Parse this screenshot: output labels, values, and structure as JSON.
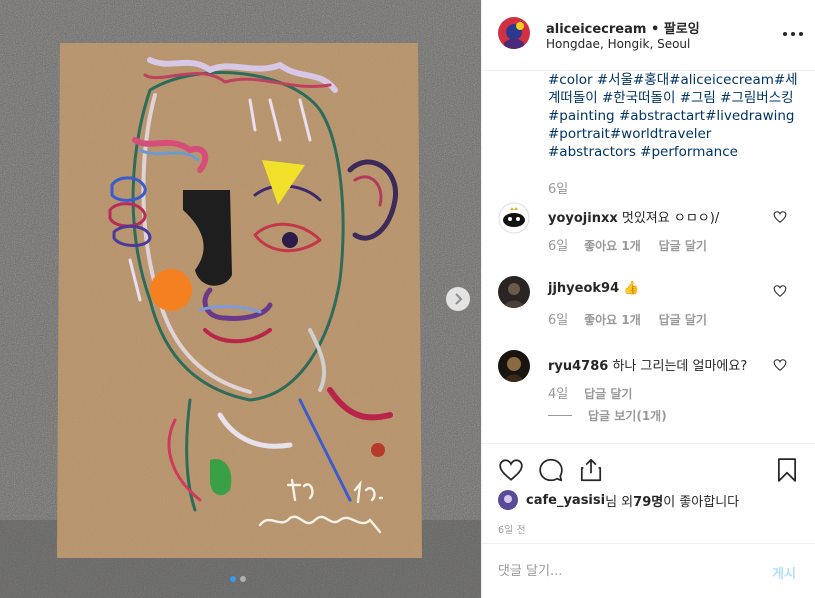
{
  "post": {
    "username": "aliceicecream",
    "separator": "•",
    "follow_label": "팔로잉",
    "location": "Hongdae, Hongik, Seoul",
    "more_options_icon": "more-options-icon"
  },
  "caption": {
    "hashtags": [
      "#color",
      "#서울",
      "#홍대",
      "#aliceicecream",
      "#세계떠돌이",
      "#한국떠돌이",
      "#그림",
      "#그림버스킹",
      "#painting",
      "#abstractart",
      "#livedrawing",
      "#portrait",
      "#worldtraveler",
      "#abstractors",
      "#performance"
    ],
    "time": "6일"
  },
  "comments": [
    {
      "user": "yoyojinxx",
      "text": "멋있져요 ㅇㅁㅇ)/",
      "time": "6일",
      "likes_label": "좋아요 1개",
      "reply_label": "답글 달기"
    },
    {
      "user": "jjhyeok94",
      "text": "👍",
      "time": "6일",
      "likes_label": "좋아요 1개",
      "reply_label": "답글 달기"
    },
    {
      "user": "ryu4786",
      "text": "하나 그리는데 얼마에요?",
      "time": "4일",
      "likes_label": "",
      "reply_label": "답글 달기"
    }
  ],
  "view_replies_label": "답글 보기(1개)",
  "likes": {
    "user": "cafe_yasisi",
    "text_mid": "님 외 ",
    "count": "79명",
    "text_end": "이 좋아합니다"
  },
  "post_time": "6일 전",
  "add_comment": {
    "placeholder": "댓글 달기...",
    "post_label": "게시"
  },
  "carousel": {
    "total": 2,
    "current": 1
  },
  "colors": {
    "link": "#003569",
    "muted": "#999999",
    "accent": "#3897f0",
    "post_disabled": "#b2dffc"
  },
  "icons": [
    "heart-icon",
    "comment-icon",
    "share-icon",
    "bookmark-icon",
    "chevron-right-icon"
  ]
}
